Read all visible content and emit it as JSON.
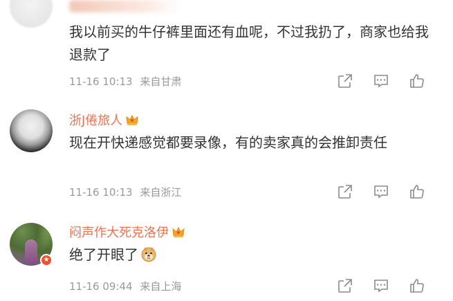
{
  "comments": [
    {
      "username": "",
      "text": "我以前买的牛仔裤里面还有血呢，不过我扔了，商家也给我退款了",
      "time": "11-16 10:13",
      "location": "来自甘肃"
    },
    {
      "username": "浙J倦旅人",
      "text": "现在开快递感觉都要录像，有的卖家真的会推卸责任",
      "time": "11-16 10:13",
      "location": "来自浙江"
    },
    {
      "username": "闷声作大死克洛伊",
      "text": "绝了开眼了",
      "time": "11-16 09:44",
      "location": "来自上海"
    }
  ],
  "icons": {
    "share": "share-icon",
    "comment": "comment-icon",
    "like": "like-icon",
    "crown": "crown-icon",
    "doge": "doge-emoji-icon"
  },
  "colors": {
    "username": "#eb7350",
    "text": "#333333",
    "meta": "#999999",
    "icon": "#8a8a8a"
  }
}
